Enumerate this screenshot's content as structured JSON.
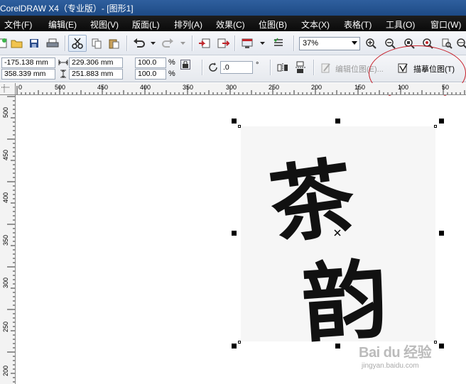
{
  "window": {
    "title": "CorelDRAW X4（专业版）- [图形1]"
  },
  "menu": [
    "文件(F)",
    "编辑(E)",
    "视图(V)",
    "版面(L)",
    "排列(A)",
    "效果(C)",
    "位图(B)",
    "文本(X)",
    "表格(T)",
    "工具(O)",
    "窗口(W)"
  ],
  "toolbar": {
    "zoom": "37%"
  },
  "property_bar": {
    "x": "-175.138 mm",
    "y": "358.339 mm",
    "width": "229.306 mm",
    "height": "251.883 mm",
    "scale_x": "100.0",
    "scale_y": "100.0",
    "percent_x": "%",
    "percent_y": "%",
    "angle": ".0",
    "degree": "°",
    "edit_bitmap": "编辑位图(E)...",
    "trace_bitmap": "描摹位图(T)"
  },
  "ruler_top": [
    "0",
    "500",
    "450",
    "400",
    "350",
    "300",
    "250",
    "200",
    "150",
    "100",
    "50"
  ],
  "ruler_left": [
    "500",
    "450",
    "400",
    "350",
    "300",
    "250",
    "200"
  ],
  "artwork": {
    "char1": "茶",
    "char2": "韵"
  },
  "watermark": {
    "logo": "Bai du 经验",
    "url": "jingyan.baidu.com"
  },
  "colors": {
    "menubar": "#0a0a0a",
    "annotation": "#c8202a",
    "title_bar": "#1d4a85"
  }
}
